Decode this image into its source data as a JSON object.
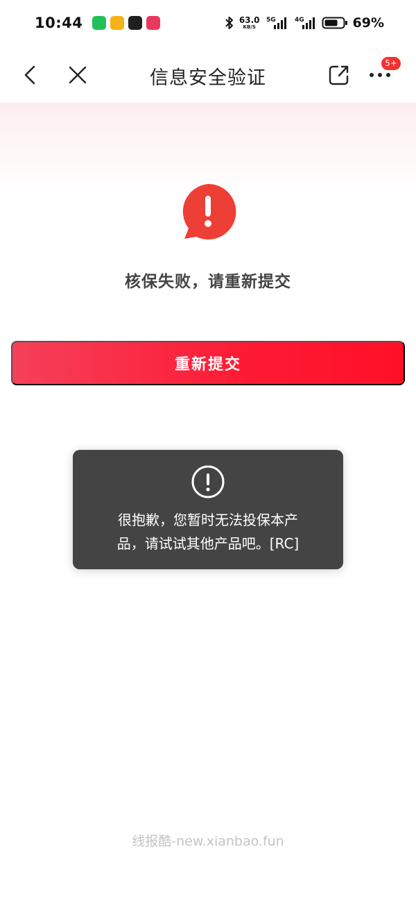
{
  "status_bar": {
    "time": "10:44",
    "net_speed_value": "63.0",
    "net_speed_unit": "KB/S",
    "net_5g": "5G",
    "net_4g": "4G",
    "battery_percent": "69%",
    "app_icon_colors": [
      "#21c05a",
      "#f6b21b",
      "#202020",
      "#e8385b"
    ]
  },
  "nav": {
    "title": "信息安全验证",
    "badge": "5+"
  },
  "result": {
    "message": "核保失败，请重新提交",
    "button_label": "重新提交"
  },
  "toast": {
    "line1": "很抱歉，您暂时无法投保本产",
    "line2": "品，请试试其他产品吧。[RC]"
  },
  "watermark": "线报酷-new.xianbao.fun",
  "colors": {
    "accent": "#fe1a34",
    "alert_red": "#ee3f36",
    "toast_bg": "#444444"
  }
}
